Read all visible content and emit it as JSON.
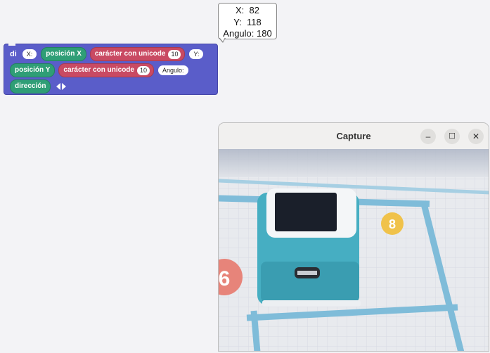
{
  "bubble": {
    "x_line": "X:  82",
    "y_line": "Y:  118",
    "angle_line": "Angulo: 180"
  },
  "say_block": {
    "label": "di",
    "x_slot": "X:",
    "pos_x": "posición X",
    "unicode_label_1": "carácter con unicode",
    "unicode_value_1": "10",
    "y_slot": "Y:",
    "pos_y": "posición Y",
    "unicode_label_2": "carácter con unicode",
    "unicode_value_2": "10",
    "angle_slot": "Angulo:",
    "direction": "dirección"
  },
  "window": {
    "title": "Capture",
    "minimize": "–",
    "maximize": "☐",
    "close": "✕"
  },
  "camera": {
    "badge_left": "6",
    "badge_right": "8"
  },
  "colors": {
    "block_purple": "#5a5dc9",
    "reporter_green": "#2f9e76",
    "reporter_red": "#c94a63",
    "robot_teal": "#46aec2"
  }
}
